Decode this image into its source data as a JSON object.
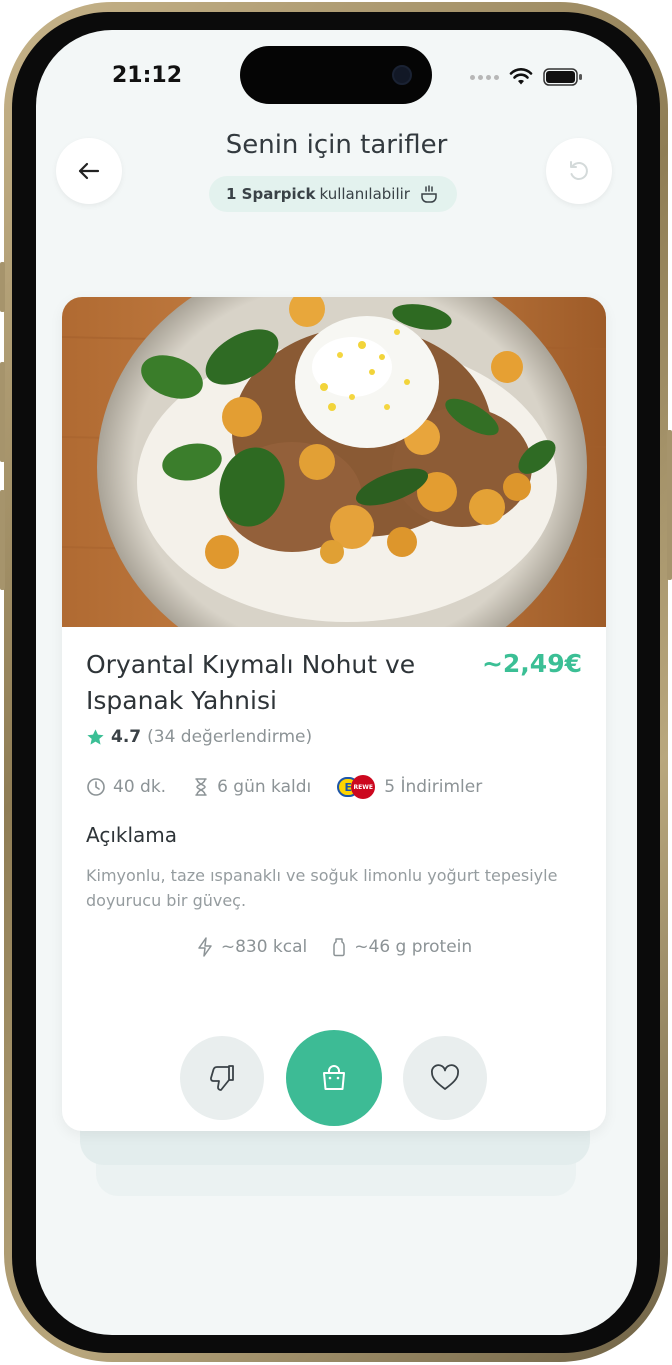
{
  "status_bar": {
    "time": "21:12"
  },
  "header": {
    "title": "Senin için tarifler",
    "badge_bold": "1 Sparpick",
    "badge_rest": "kullanılabilir",
    "back_icon": "arrow-left-icon",
    "refresh_icon": "refresh-icon"
  },
  "recipe": {
    "title": "Oryantal Kıymalı Nohut ve Ispanak Yahnisi",
    "price": "~2,49€",
    "rating_value": "4.7",
    "rating_count": "(34 değerlendirme)",
    "duration": "40 dk.",
    "days_left": "6 gün kaldı",
    "discounts": "5 İndirimler",
    "store_logo_1": "E",
    "store_logo_2": "REWE",
    "section_heading": "Açıklama",
    "description": "Kimyonlu, taze ıspanaklı ve soğuk limonlu yoğurt tepesiyle doyurucu bir güveç.",
    "calories": "~830 kcal",
    "protein": "~46 g protein"
  },
  "actions": {
    "dislike_icon": "thumbs-down-icon",
    "shop_icon": "shopping-bag-icon",
    "like_icon": "heart-icon"
  },
  "colors": {
    "accent": "#3dbb95",
    "price": "#3bbf95",
    "screen_bg": "#f3f7f7",
    "badge_bg": "#e3f2ee"
  }
}
